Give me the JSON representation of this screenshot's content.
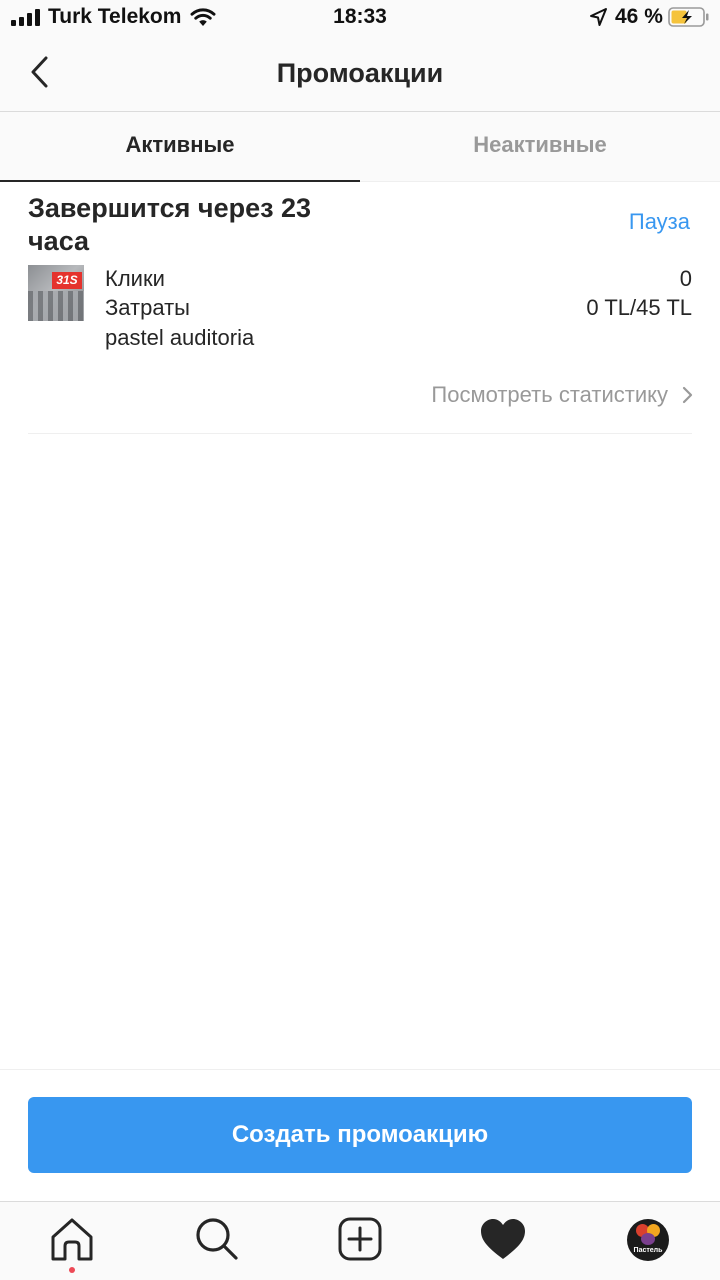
{
  "status_bar": {
    "carrier": "Turk Telekom",
    "time": "18:33",
    "battery_percent": "46 %",
    "icons": [
      "signal-icon",
      "wifi-icon",
      "location-arrow-icon",
      "battery-charging-icon"
    ]
  },
  "header": {
    "title": "Промоакции",
    "back_icon": "chevron-left-icon"
  },
  "tabs": [
    {
      "label": "Активные",
      "active": true
    },
    {
      "label": "Неактивные",
      "active": false
    }
  ],
  "promotion": {
    "headline": "Завершится через 23 часа",
    "pause_label": "Пауза",
    "stats": [
      {
        "label": "Клики",
        "value": "0"
      },
      {
        "label": "Затраты",
        "value": "0 TL/45 TL"
      },
      {
        "label": "pastel auditoria",
        "value": ""
      }
    ],
    "view_stats_label": "Посмотреть статистику",
    "thumbnail_logo": "31S"
  },
  "create_button": {
    "label": "Создать промоакцию"
  },
  "tabbar": {
    "items": [
      "home-icon",
      "search-icon",
      "new-post-icon",
      "activity-heart-icon",
      "profile-avatar"
    ],
    "avatar_text": "Пастель"
  },
  "colors": {
    "accent": "#3897f0",
    "text": "#262626",
    "muted": "#999999",
    "notification_dot": "#ed4956"
  }
}
